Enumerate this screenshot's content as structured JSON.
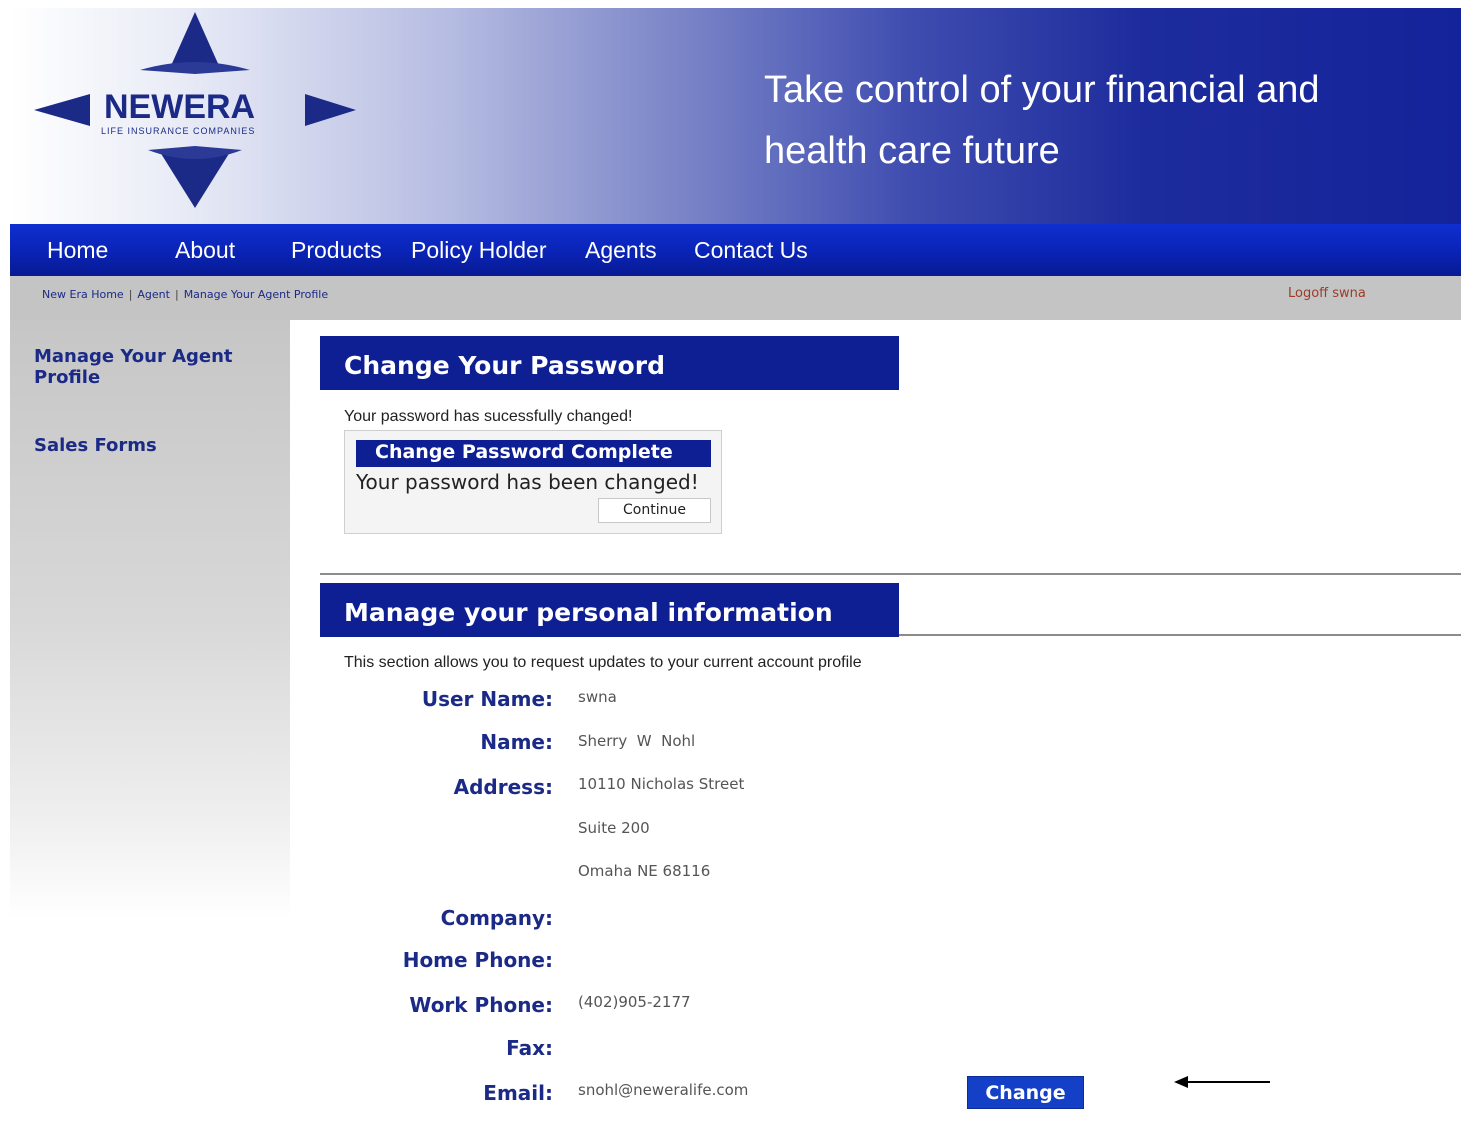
{
  "brand": {
    "logo_text": "NEWERA",
    "logo_subtext": "LIFE INSURANCE COMPANIES",
    "tagline_line1": "Take control of your financial and",
    "tagline_line2": "health care future",
    "colors": {
      "navy": "#0d1f93",
      "nav_blue": "#0a23b5",
      "link_navy": "#1b2a86",
      "button_blue": "#1440c8"
    }
  },
  "nav": {
    "items": [
      "Home",
      "About",
      "Products",
      "Policy Holder",
      "Agents",
      "Contact Us"
    ]
  },
  "breadcrumb": {
    "items": [
      "New Era Home",
      "Agent",
      "Manage Your Agent Profile"
    ],
    "separator": "|",
    "logoff": "Logoff swna"
  },
  "sidebar": {
    "items": [
      "Manage Your Agent Profile",
      "Sales Forms"
    ]
  },
  "password_section": {
    "title": "Change Your Password",
    "note": "Your password has sucessfully changed!",
    "box_title": "Change Password Complete",
    "box_message": "Your password has been changed!",
    "continue_label": "Continue"
  },
  "personal_section": {
    "title": "Manage your personal information",
    "note": "This section allows you to request updates to your current account profile",
    "fields": {
      "user_name": {
        "label": "User Name:",
        "value": "swna"
      },
      "name": {
        "label": "Name:",
        "value": "Sherry  W  Nohl"
      },
      "address": {
        "label": "Address:",
        "line1": "10110 Nicholas Street",
        "line2": "Suite 200",
        "line3": "Omaha NE 68116"
      },
      "company": {
        "label": "Company:",
        "value": ""
      },
      "home_phone": {
        "label": "Home Phone:",
        "value": ""
      },
      "work_phone": {
        "label": "Work Phone:",
        "value": "(402)905-2177"
      },
      "fax": {
        "label": "Fax:",
        "value": ""
      },
      "email": {
        "label": "Email:",
        "value": "snohl@neweralife.com"
      }
    },
    "change_label": "Change",
    "annotation_icon": "left-arrow-icon"
  }
}
